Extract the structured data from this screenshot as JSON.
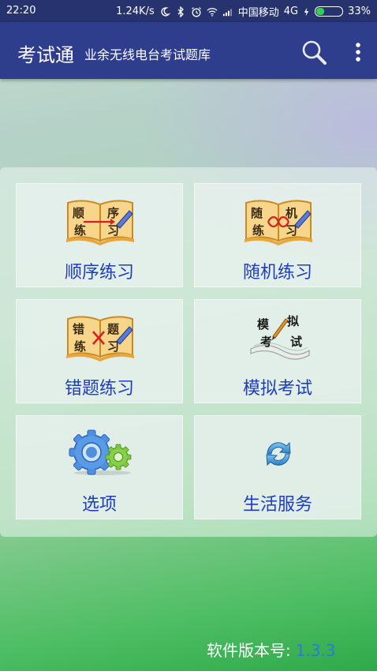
{
  "status": {
    "time": "22:20",
    "speed": "1.24K/s",
    "carrier": "中国移动",
    "network": "4G",
    "battery": "33%",
    "battery_level": 0.33
  },
  "appbar": {
    "title": "考试通",
    "subtitle": "业余无线电台考试题库"
  },
  "tiles": [
    {
      "label": "顺序练习",
      "icon": "book-sequential-icon",
      "chars": [
        "顺",
        "序",
        "练",
        "习"
      ]
    },
    {
      "label": "随机练习",
      "icon": "book-random-icon",
      "chars": [
        "随",
        "机",
        "练",
        "习"
      ]
    },
    {
      "label": "错题练习",
      "icon": "book-wrong-icon",
      "chars": [
        "错",
        "题",
        "练",
        "习"
      ]
    },
    {
      "label": "模拟考试",
      "icon": "exam-scroll-icon",
      "chars": [
        "模",
        "拟",
        "考",
        "试"
      ]
    },
    {
      "label": "选项",
      "icon": "gears-icon"
    },
    {
      "label": "生活服务",
      "icon": "refresh-icon"
    }
  ],
  "footer": {
    "version_label": "软件版本号:",
    "version_value": "1.3.3"
  },
  "colors": {
    "status_bar": "#27336f",
    "app_bar": "#2f3d8d",
    "tile_label": "#1e3dbb",
    "version_value": "#2e7bd6"
  }
}
